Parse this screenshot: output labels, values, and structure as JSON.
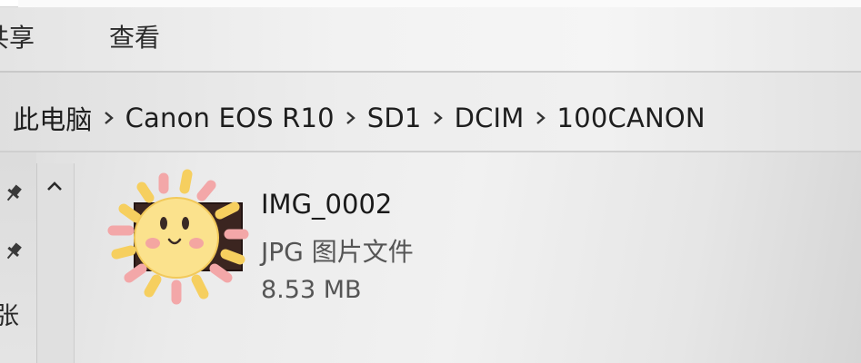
{
  "ribbon": {
    "tabs": [
      {
        "label": "共享"
      },
      {
        "label": "查看"
      }
    ]
  },
  "address": {
    "crumbs": [
      "此电脑",
      "Canon EOS R10",
      "SD1",
      "DCIM",
      "100CANON"
    ]
  },
  "nav": {
    "partial_label": "张"
  },
  "file": {
    "name": "IMG_0002",
    "type": "JPG 图片文件",
    "size": "8.53 MB",
    "thumbnail_overlay": "sun-sticker-icon"
  },
  "colors": {
    "sticker_face": "#fbe28d",
    "sticker_ray_yellow": "#f6cf5f",
    "sticker_ray_pink": "#f3a7a8"
  }
}
